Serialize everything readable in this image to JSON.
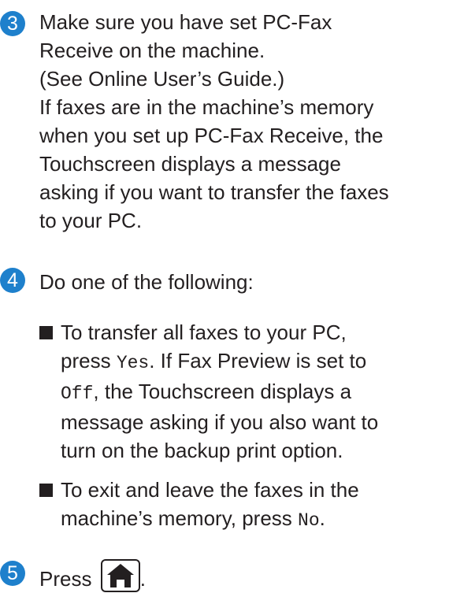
{
  "accent_color": "#1e80cc",
  "step3": {
    "number": "3",
    "lines": [
      "Make sure you have set PC-Fax",
      "Receive on the machine.",
      "(See Online User’s Guide.)",
      "If faxes are in the machine’s memory",
      "when you set up PC-Fax Receive, the",
      "Touchscreen displays a message",
      "asking if you want to transfer the faxes",
      "to your PC."
    ]
  },
  "step4": {
    "number": "4",
    "intro": "Do one of the following:",
    "bullet1": {
      "l1": "To transfer all faxes to your PC,",
      "l2_a": "press ",
      "l2_code": "Yes",
      "l2_b": ". If Fax Preview is set to",
      "l3_code": "Off",
      "l3_b": ", the Touchscreen displays a",
      "l4": "message asking if you also want to",
      "l5": "turn on the backup print option."
    },
    "bullet2": {
      "l1": "To exit and leave the faxes in the",
      "l2_a": "machine’s memory, press ",
      "l2_code": "No",
      "l2_b": "."
    }
  },
  "step5": {
    "number": "5",
    "text": "Press",
    "icon": "home-icon",
    "after": "."
  }
}
